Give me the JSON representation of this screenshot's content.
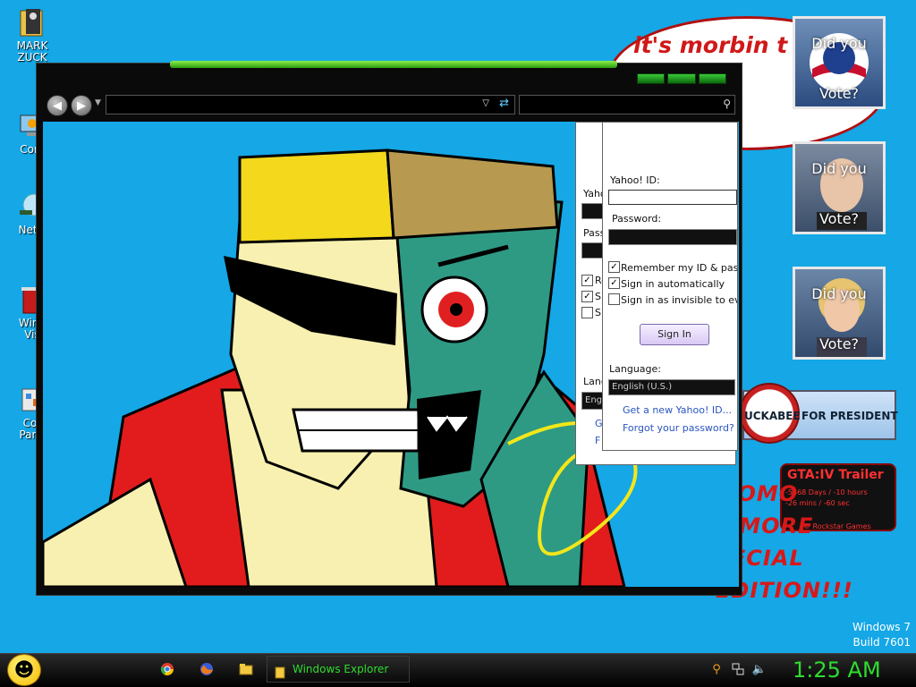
{
  "desktop": {
    "icons": [
      {
        "label": "MARK\nZUCK",
        "icon": "folder-icon"
      },
      {
        "label": "Com",
        "icon": "computer-icon"
      },
      {
        "label": "Netw",
        "icon": "network-icon"
      },
      {
        "label": "Wind\nVis",
        "icon": "recycle-bin-icon"
      },
      {
        "label": "Cor\nPane",
        "icon": "control-panel-icon"
      }
    ],
    "bubble_text": "it's morbin t",
    "candidate_tiles": [
      {
        "top_text": "Did you",
        "bottom_text": "Vote?"
      },
      {
        "top_text": "Did you",
        "bottom_text": "Vote?"
      },
      {
        "top_text": "Did you",
        "bottom_text": "Vote?"
      }
    ],
    "huckabee_banner": {
      "name": "UCKABEE",
      "suffix": "FOR PRESIDENT"
    },
    "gta_gadget": {
      "title": "GTA:IV Trailer",
      "line1": "-5668 Days / -10 hours",
      "line2": "-26 mins / -60 sec",
      "line3": "© Rockstar Games"
    },
    "scrawl_lines": [
      "VMOMO",
      "MOMORE",
      "SPECIAL",
      "EDITION!!!"
    ],
    "windows_version": {
      "line1": "Windows 7",
      "line2": "Build 7601"
    }
  },
  "explorer": {
    "back_icon": "back-arrow-icon",
    "forward_icon": "forward-arrow-icon",
    "address_value": "",
    "search_value": ""
  },
  "yahoo_back": {
    "labels": [
      "Yaho",
      "Pass",
      "Re",
      "Si",
      "Si",
      "Lang",
      "Engl",
      "G",
      "F"
    ]
  },
  "yahoo_login": {
    "id_label": "Yahoo! ID:",
    "password_label": "Password:",
    "remember_label": "Remember my ID & passwo",
    "auto_label": "Sign in automatically",
    "invisible_label": "Sign in as invisible to every",
    "remember_checked": true,
    "auto_checked": true,
    "invisible_checked": false,
    "signin_label": "Sign In",
    "language_label": "Language:",
    "language_value": "English (U.S.)",
    "new_id_link": "Get a new Yahoo! ID...",
    "forgot_link": "Forgot your password?"
  },
  "taskbar": {
    "start_icon": "smiley-start-icon",
    "pinned": [
      "chrome-icon",
      "firefox-icon",
      "folder-icon"
    ],
    "task_label": "Windows Explorer",
    "tray_icons": [
      "search-icon",
      "network-icon",
      "volume-icon"
    ],
    "clock": "1:25 AM"
  }
}
